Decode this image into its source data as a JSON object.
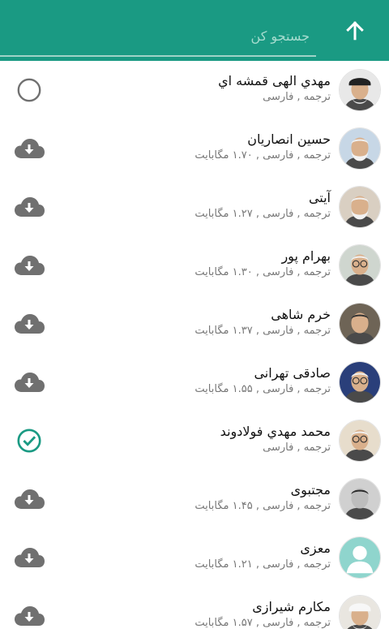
{
  "header": {
    "search_placeholder": "جستجو کن",
    "back_icon": "arrow-up-icon",
    "colors": {
      "appbar": "#1a9a83",
      "accent": "#1a9a83",
      "underline": "#9fd3c8"
    }
  },
  "translations": [
    {
      "name": "مهدي الهی قمشه اي",
      "meta": "ترجمه , فارسی",
      "action": "radio-empty",
      "avatar": "turban"
    },
    {
      "name": "حسين انصاريان",
      "meta": "ترجمه , فارسی , ۱.۷۰ مگابایت",
      "action": "download",
      "avatar": "elder-white"
    },
    {
      "name": "آیتی",
      "meta": "ترجمه , فارسی , ۱.۲۷ مگابایت",
      "action": "download",
      "avatar": "beard"
    },
    {
      "name": "بهرام پور",
      "meta": "ترجمه , فارسی , ۱.۳۰ مگابایت",
      "action": "download",
      "avatar": "glasses"
    },
    {
      "name": "خرم شاهی",
      "meta": "ترجمه , فارسی , ۱.۳۷ مگابایت",
      "action": "download",
      "avatar": "dark"
    },
    {
      "name": "صادقی تهرانی",
      "meta": "ترجمه , فارسی , ۱.۵۵ مگابایت",
      "action": "download",
      "avatar": "blue-bg"
    },
    {
      "name": "محمد مهدي فولادوند",
      "meta": "ترجمه , فارسی",
      "action": "checked",
      "avatar": "glasses-light"
    },
    {
      "name": "مجتبوی",
      "meta": "ترجمه , فارسی , ۱.۴۵ مگابایت",
      "action": "download",
      "avatar": "bw"
    },
    {
      "name": "معزی",
      "meta": "ترجمه , فارسی , ۱.۲۱ مگابایت",
      "action": "download",
      "avatar": "placeholder"
    },
    {
      "name": "مکارم شیرازی",
      "meta": "ترجمه , فارسی , ۱.۵۷ مگابایت",
      "action": "download",
      "avatar": "turban-white"
    }
  ]
}
